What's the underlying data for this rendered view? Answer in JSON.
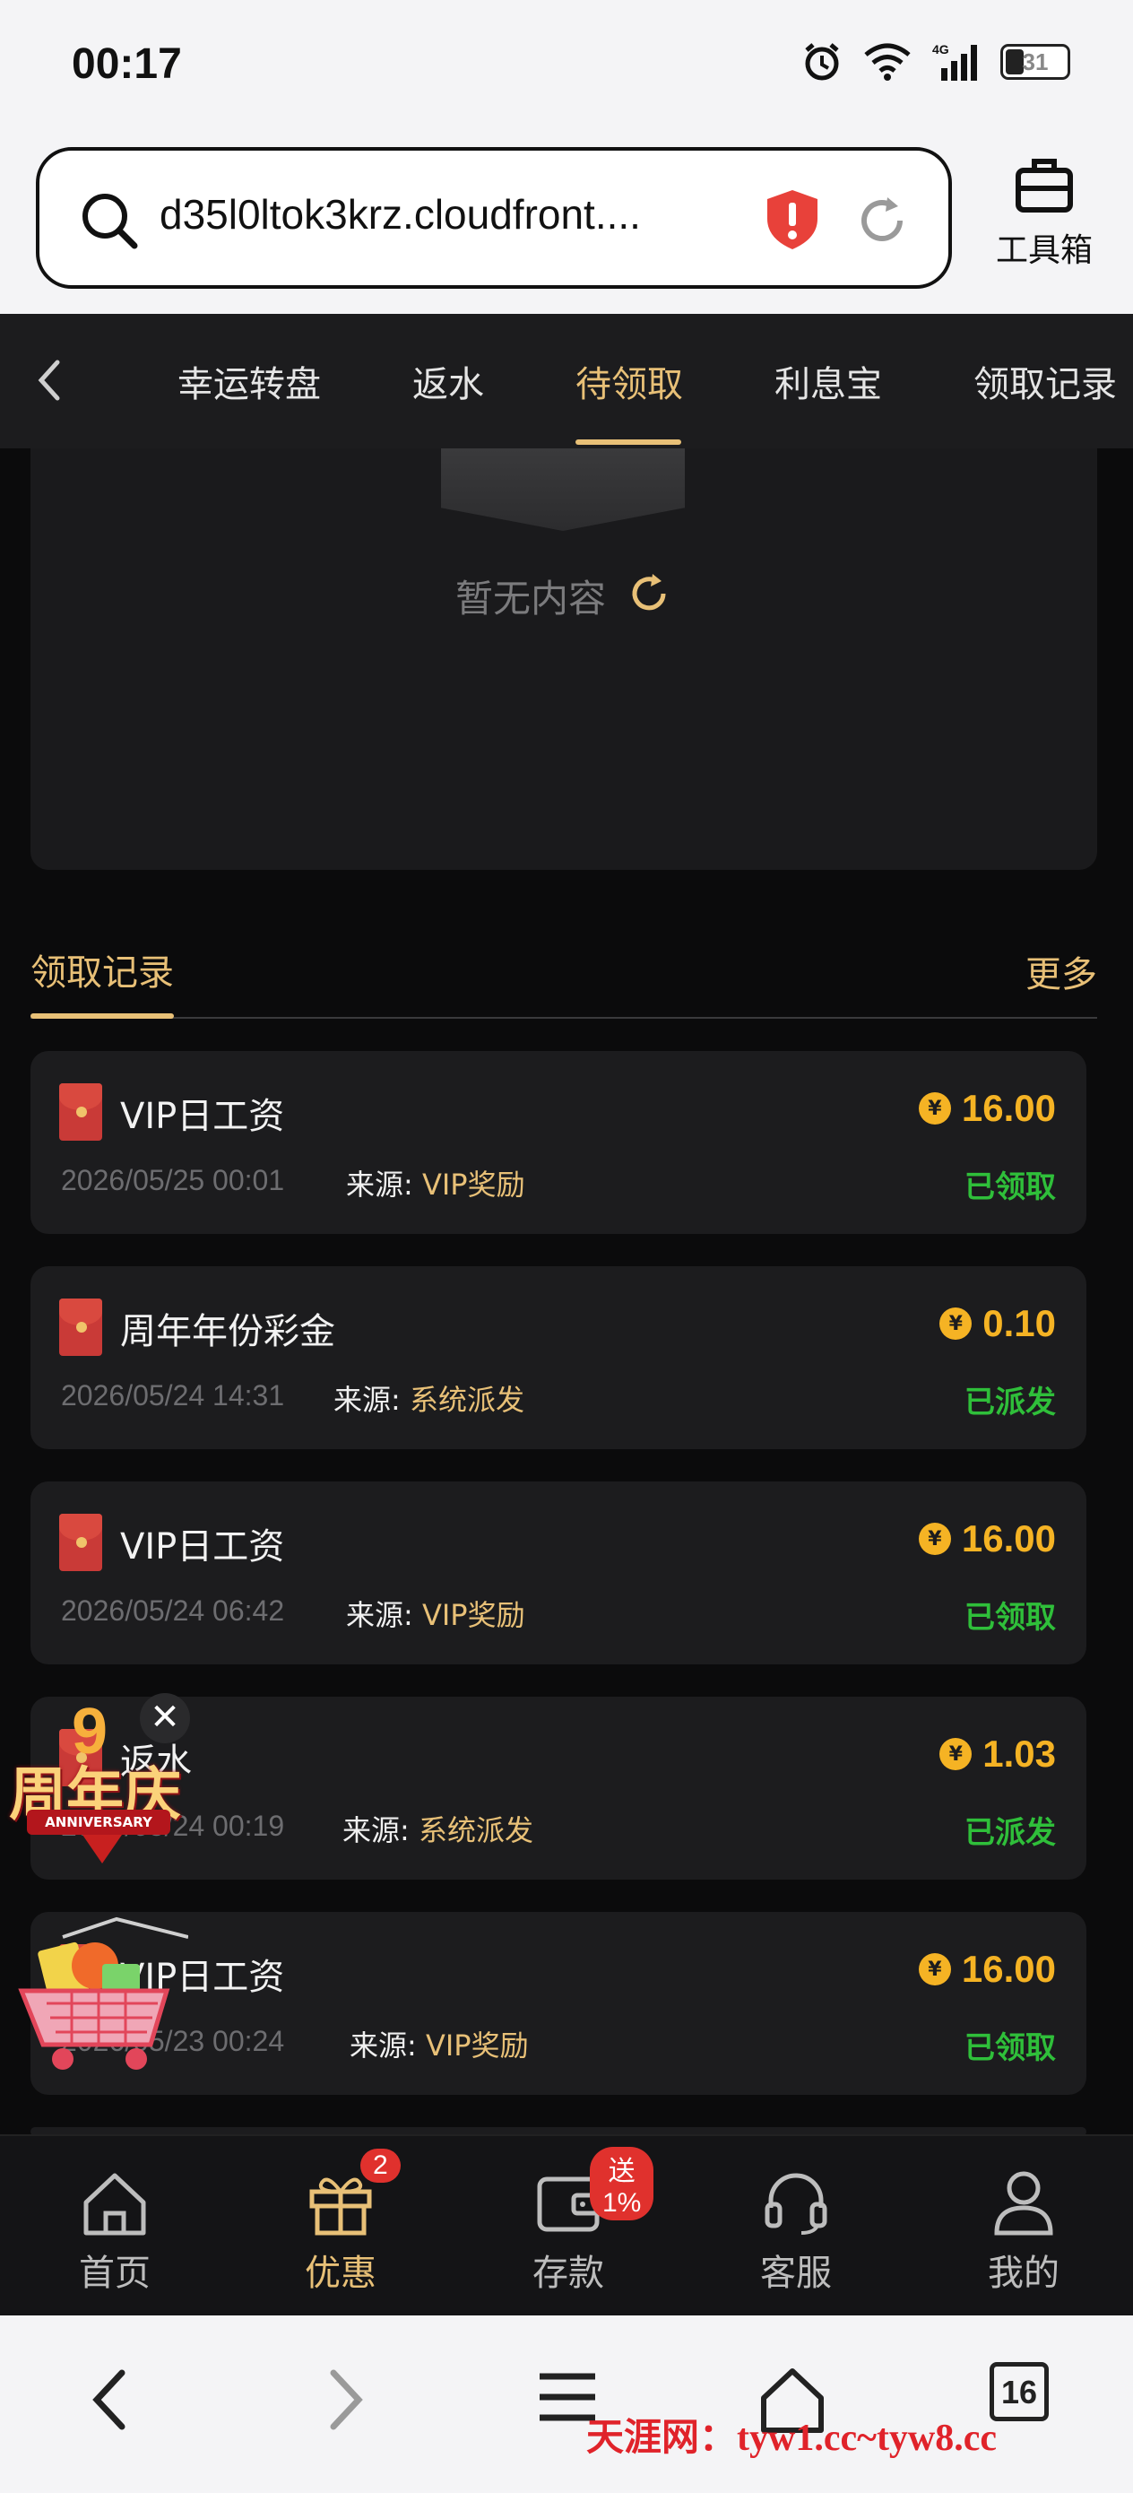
{
  "status_bar": {
    "time": "00:17",
    "battery": "31",
    "network": "4G"
  },
  "browser": {
    "url": "d35l0ltok3krz.cloudfront....",
    "toolbox_label": "工具箱",
    "tabs_count": "16"
  },
  "tabs": [
    {
      "label": "幸运转盘"
    },
    {
      "label": "返水"
    },
    {
      "label": "待领取",
      "active": true
    },
    {
      "label": "利息宝"
    },
    {
      "label": "领取记录"
    }
  ],
  "empty_state": {
    "text": "暂无内容"
  },
  "records_section": {
    "title": "领取记录",
    "more": "更多"
  },
  "source_prefix": "来源:",
  "records": [
    {
      "title": "VIP日工资",
      "date": "2026/05/25 00:01",
      "source": "VIP奖励",
      "amount": "16.00",
      "status": "已领取"
    },
    {
      "title": "周年年份彩金",
      "date": "2026/05/24 14:31",
      "source": "系统派发",
      "amount": "0.10",
      "status": "已派发"
    },
    {
      "title": "VIP日工资",
      "date": "2026/05/24 06:42",
      "source": "VIP奖励",
      "amount": "16.00",
      "status": "已领取"
    },
    {
      "title": "返水",
      "date": "2026/05/24 00:19",
      "source": "系统派发",
      "amount": "1.03",
      "status": "已派发"
    },
    {
      "title": "VIP日工资",
      "date": "2026/05/23 00:24",
      "source": "VIP奖励",
      "amount": "16.00",
      "status": "已领取"
    }
  ],
  "coin_symbol": "¥",
  "floating": {
    "anniv_number": "9",
    "anniv_text": "周年庆",
    "anniv_ribbon": "ANNIVERSARY",
    "close": "✕"
  },
  "app_nav": [
    {
      "label": "首页"
    },
    {
      "label": "优惠",
      "active": true,
      "badge": "2"
    },
    {
      "label": "存款",
      "badge": "送1%"
    },
    {
      "label": "客服"
    },
    {
      "label": "我的"
    }
  ],
  "watermark": "天涯网：tyw1.cc~tyw8.cc",
  "colors": {
    "accent": "#e8c077",
    "amount": "#f5b324",
    "status_green": "#2fbf3a",
    "background": "#0b0b0c",
    "card": "#1c1c1e"
  }
}
